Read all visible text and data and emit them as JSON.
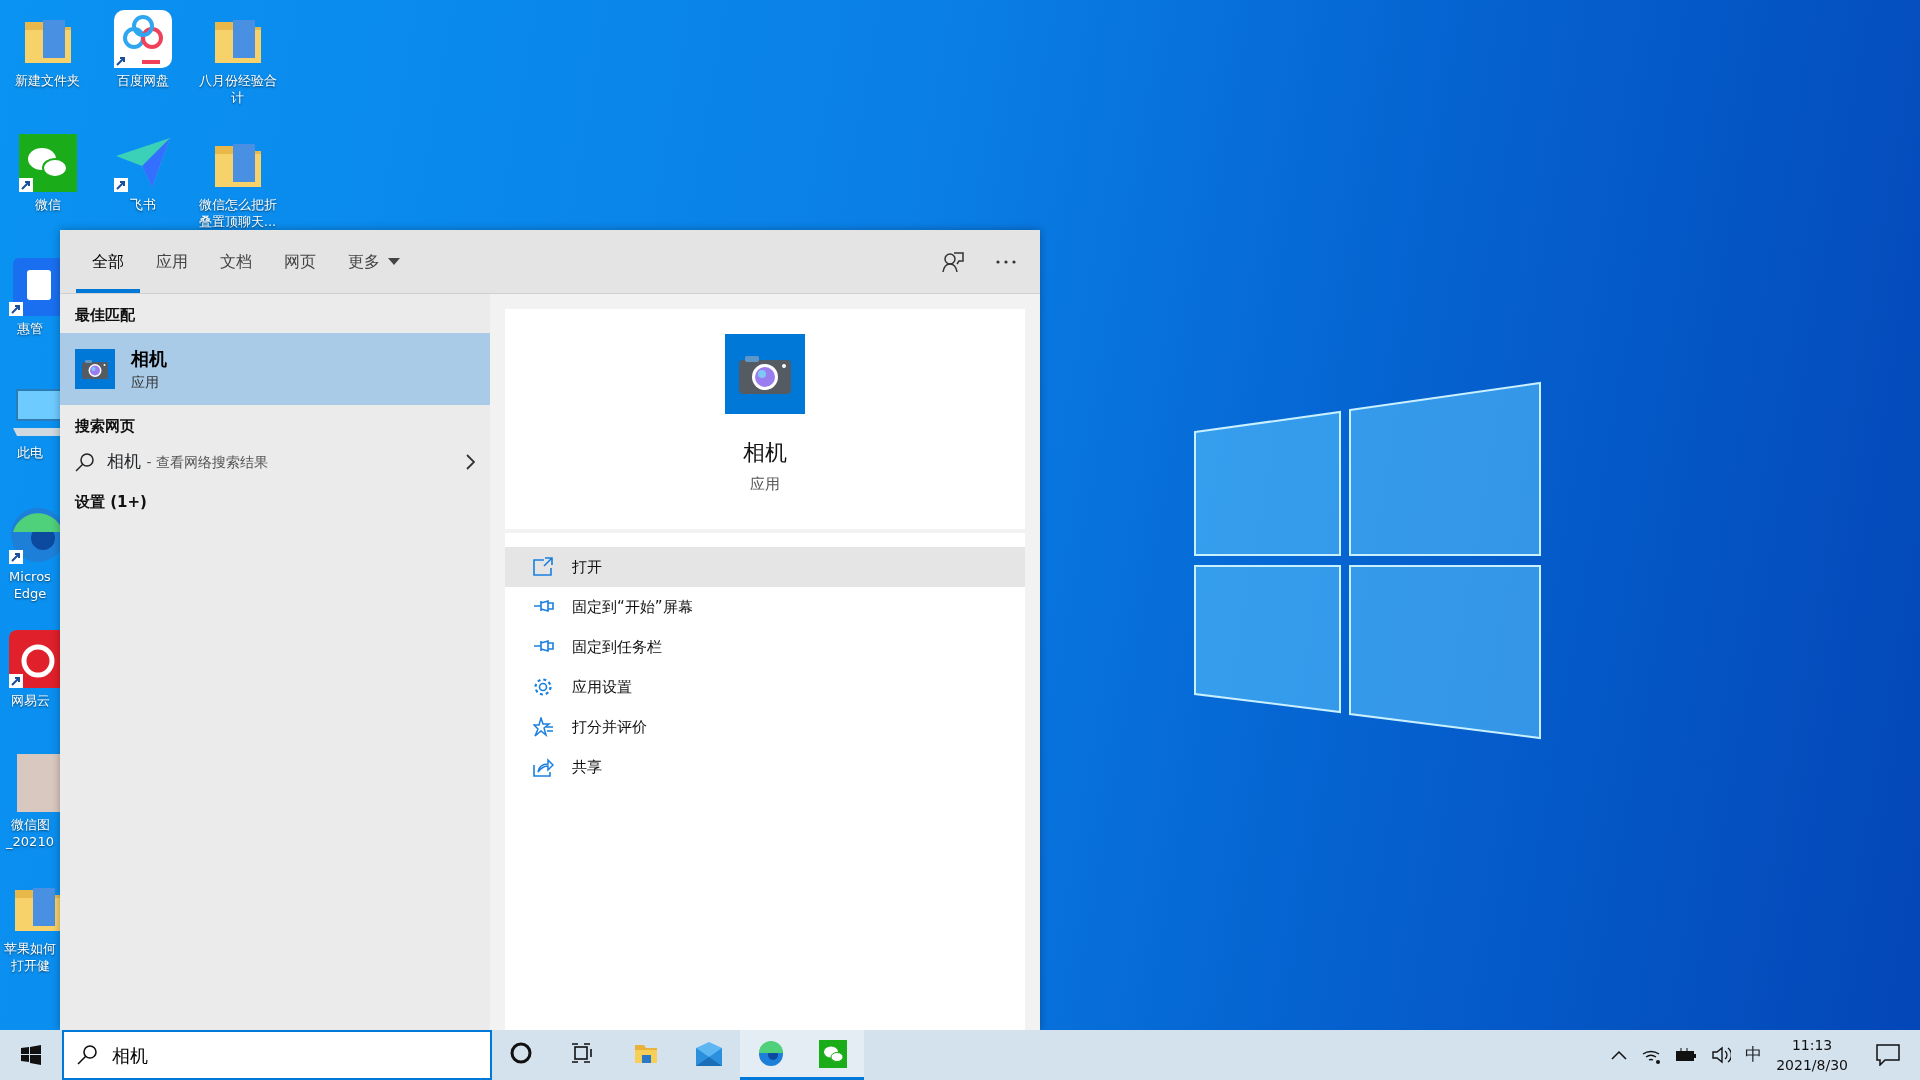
{
  "desktop_columns": [
    [
      {
        "label_lines": [
          "新建文件夹"
        ],
        "kind": "folder",
        "shortcut": false
      },
      {
        "label_lines": [
          "微信"
        ],
        "kind": "chat",
        "shortcut": true
      },
      {
        "label_lines": [
          "惠管"
        ],
        "kind": "blue-app",
        "shortcut": true
      },
      {
        "label_lines": [
          "此电"
        ],
        "kind": "computer",
        "shortcut": false
      },
      {
        "label_lines": [
          "Micros",
          "Edge"
        ],
        "kind": "browser",
        "shortcut": true
      },
      {
        "label_lines": [
          "网易云"
        ],
        "kind": "music",
        "shortcut": true
      },
      {
        "label_lines": [
          "微信图",
          "_20210"
        ],
        "kind": "photo",
        "shortcut": false
      },
      {
        "label_lines": [
          "苹果如何",
          "打开健"
        ],
        "kind": "folder",
        "shortcut": false
      }
    ],
    [
      {
        "label_lines": [
          "百度网盘"
        ],
        "kind": "cloud",
        "shortcut": true
      },
      {
        "label_lines": [
          "飞书"
        ],
        "kind": "plane",
        "shortcut": true
      }
    ],
    [
      {
        "label_lines": [
          "八月份经验合",
          "计"
        ],
        "kind": "folder",
        "shortcut": false
      },
      {
        "label_lines": [
          "微信怎么把折",
          "叠置顶聊天..."
        ],
        "kind": "folder",
        "shortcut": false
      }
    ]
  ],
  "search_panel": {
    "tabs": [
      {
        "label": "全部",
        "selected": true,
        "dropdown": false
      },
      {
        "label": "应用",
        "selected": false,
        "dropdown": false
      },
      {
        "label": "文档",
        "selected": false,
        "dropdown": false
      },
      {
        "label": "网页",
        "selected": false,
        "dropdown": false
      },
      {
        "label": "更多",
        "selected": false,
        "dropdown": true
      }
    ],
    "results": [
      {
        "kind": "heading",
        "text": "最佳匹配"
      },
      {
        "kind": "app",
        "title": "相机",
        "subtitle": "应用",
        "selected": true
      },
      {
        "kind": "heading",
        "text": "搜索网页"
      },
      {
        "kind": "web",
        "title": "相机",
        "subtitle": "- 查看网络搜索结果"
      },
      {
        "kind": "heading",
        "text": "设置 (1+)"
      }
    ],
    "preview": {
      "title": "相机",
      "subtitle": "应用"
    },
    "actions": [
      {
        "label": "打开",
        "kind": "open",
        "selected": true
      },
      {
        "label": "固定到“开始”屏幕",
        "kind": "pin",
        "selected": false
      },
      {
        "label": "固定到任务栏",
        "kind": "pin",
        "selected": false
      },
      {
        "label": "应用设置",
        "kind": "settings",
        "selected": false
      },
      {
        "label": "打分并评价",
        "kind": "rate",
        "selected": false
      },
      {
        "label": "共享",
        "kind": "share",
        "selected": false
      }
    ]
  },
  "taskbar": {
    "search_value": "相机",
    "apps": [
      {
        "kind": "cortana",
        "active": false
      },
      {
        "kind": "taskview",
        "active": false
      },
      {
        "kind": "explorer",
        "active": false
      },
      {
        "kind": "mail",
        "active": false
      },
      {
        "kind": "browser",
        "active": true
      },
      {
        "kind": "chat",
        "active": true
      }
    ],
    "ime": "中",
    "time": "11:13",
    "date": "2021/8/30"
  }
}
